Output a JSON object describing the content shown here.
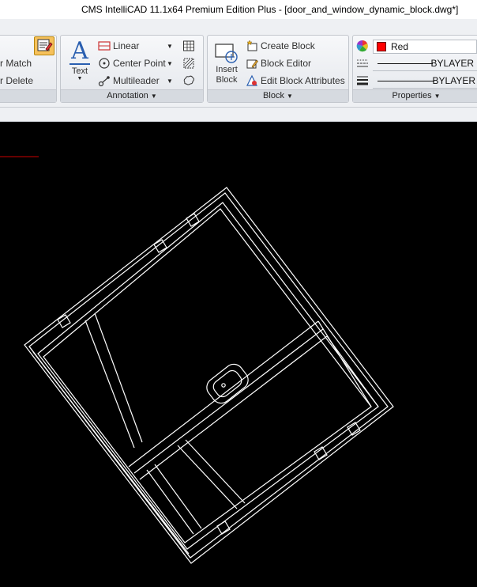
{
  "window": {
    "title": "CMS IntelliCAD 11.1x64 Premium Edition Plus  - [door_and_window_dynamic_block.dwg*]"
  },
  "ribbon": {
    "partial_group": {
      "match_label": "r Match",
      "delete_label": "r Delete"
    },
    "annotation": {
      "label": "Annotation",
      "text_label": "Text",
      "linear_label": "Linear",
      "center_point_label": "Center Point",
      "multileader_label": "Multileader"
    },
    "block": {
      "label": "Block",
      "insert_label_1": "Insert",
      "insert_label_2": "Block",
      "create_label": "Create Block",
      "editor_label": "Block Editor",
      "edit_attributes_label": "Edit Block Attributes"
    },
    "properties": {
      "label": "Properties",
      "color_value": "Red",
      "color_hex": "#ff0000",
      "linetype_value": "BYLAYER",
      "lineweight_value": "BYLAYER"
    }
  },
  "canvas": {
    "background": "#000000",
    "stroke": "#ffffff",
    "accent_line": "#cc0000"
  }
}
